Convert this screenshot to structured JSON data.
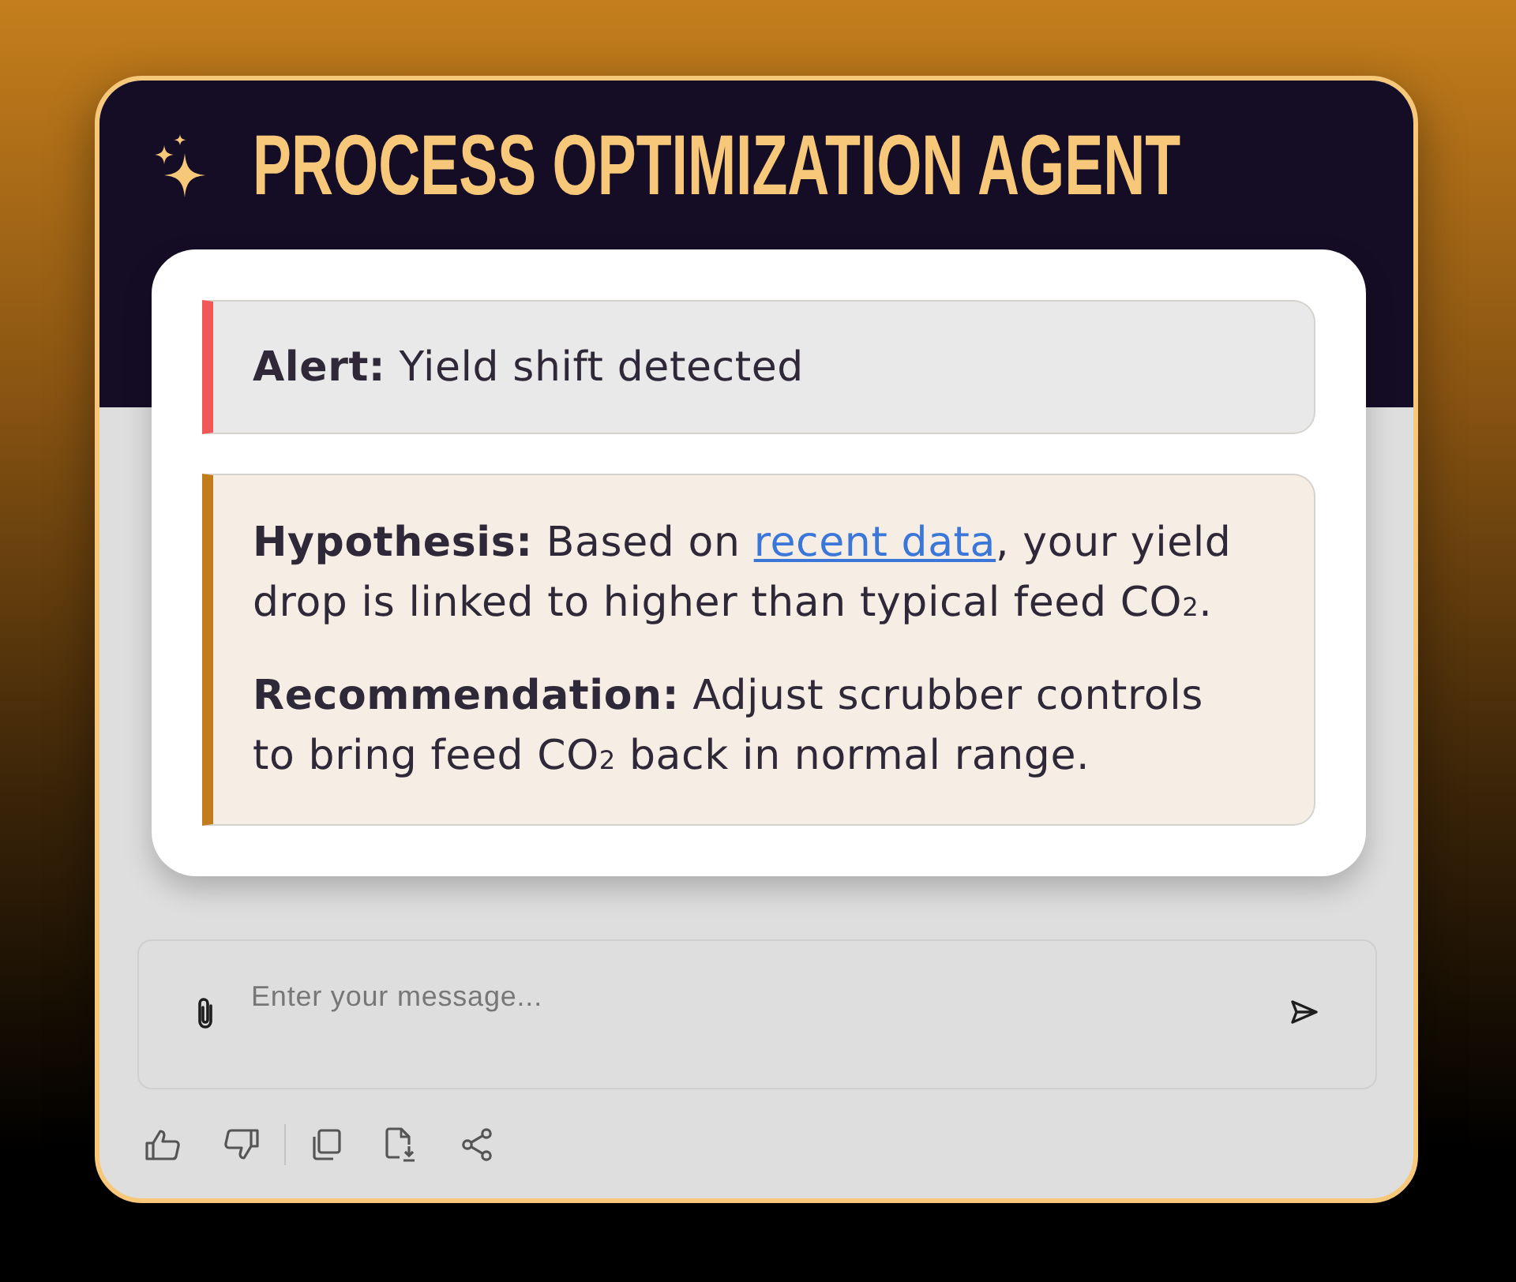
{
  "header": {
    "title": "PROCESS OPTIMIZATION AGENT"
  },
  "messages": [
    {
      "kind": "alert",
      "paragraphs": [
        {
          "before": "**Alert:** Yield shift detected"
        }
      ]
    },
    {
      "kind": "insight",
      "paragraphs": [
        {
          "before": "**Hypothesis:** Based on ",
          "link": "recent data",
          "after": ", your yield drop is linked to higher than typical feed CO$_{2}$."
        },
        {
          "before": "**Recommendation:** Adjust scrubber controls to bring feed CO$_{2}$ back in normal range."
        }
      ]
    }
  ],
  "composer": {
    "placeholder": "Enter your message..."
  }
}
